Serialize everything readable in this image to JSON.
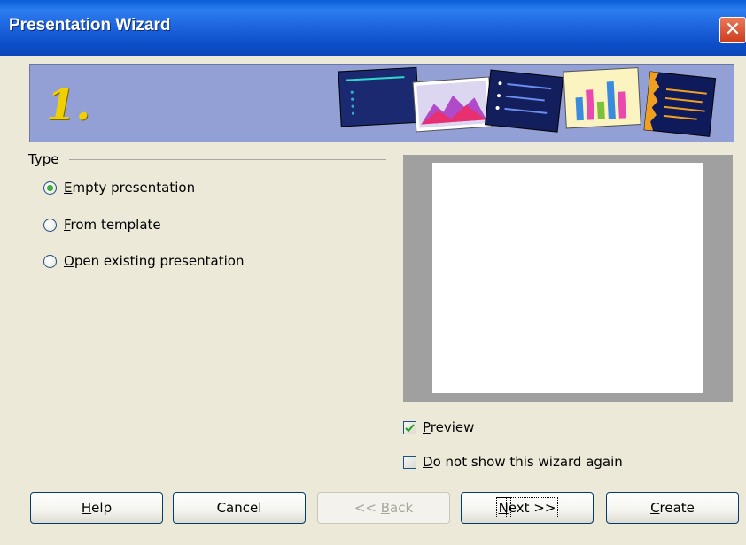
{
  "window": {
    "title": "Presentation Wizard",
    "close_glyph": "✕"
  },
  "banner": {
    "step": "1.",
    "background_color": "#93a0d6",
    "step_color": "#f0d000"
  },
  "type_group": {
    "label": "Type",
    "options": [
      {
        "prefix": "",
        "accel": "E",
        "rest": "mpty presentation",
        "selected": true
      },
      {
        "prefix": "",
        "accel": "F",
        "rest": "rom template",
        "selected": false
      },
      {
        "prefix": "",
        "accel": "O",
        "rest": "pen existing presentation",
        "selected": false
      }
    ]
  },
  "preview_checkbox": {
    "accel": "P",
    "rest": "review",
    "checked": true
  },
  "dont_show_checkbox": {
    "accel": "D",
    "rest": "o not show this wizard again",
    "checked": false
  },
  "buttons": {
    "help": {
      "prefix": "",
      "accel": "H",
      "rest": "elp"
    },
    "cancel": {
      "label": "Cancel"
    },
    "back": {
      "prefix": "<< ",
      "accel": "B",
      "rest": "ack"
    },
    "next": {
      "prefix": "",
      "accel": "N",
      "rest": "ext >>"
    },
    "create": {
      "prefix": "",
      "accel": "C",
      "rest": "reate"
    }
  },
  "icons": [
    "close-icon",
    "slide-graphic-icons",
    "radio-icons",
    "checkmark-icon"
  ]
}
